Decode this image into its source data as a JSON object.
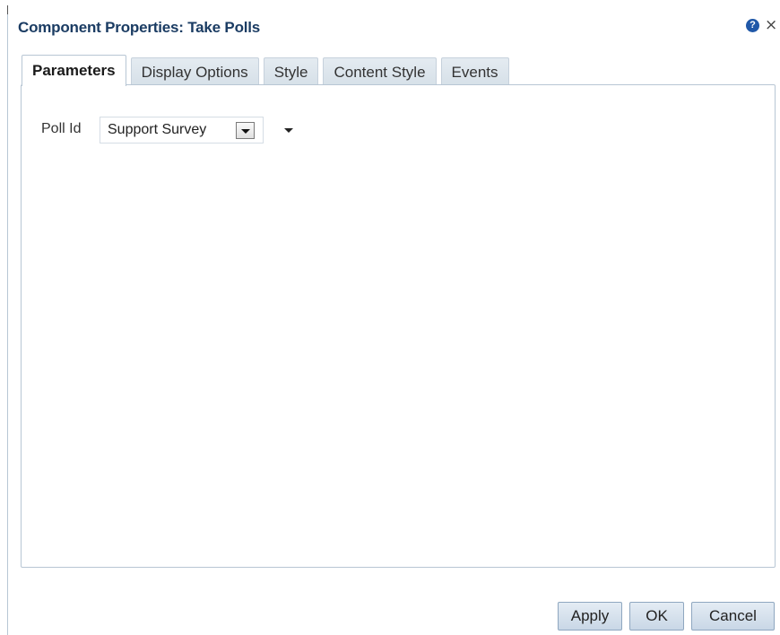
{
  "dialog": {
    "title": "Component Properties: Take Polls",
    "help_icon": "help-icon",
    "help_glyph": "?",
    "close_icon": "close-icon",
    "close_glyph": "×"
  },
  "tabs": [
    {
      "label": "Parameters",
      "active": true
    },
    {
      "label": "Display Options",
      "active": false
    },
    {
      "label": "Style",
      "active": false
    },
    {
      "label": "Content Style",
      "active": false
    },
    {
      "label": "Events",
      "active": false
    }
  ],
  "parameters": {
    "poll_id_label": "Poll Id",
    "poll_id_value": "Support Survey"
  },
  "buttons": {
    "apply": "Apply",
    "ok": "OK",
    "cancel": "Cancel"
  },
  "colors": {
    "title": "#1b3c63",
    "help_icon": "#2058a8",
    "tab_inactive": "#d6e0e8",
    "button": "#c9d7e6"
  }
}
